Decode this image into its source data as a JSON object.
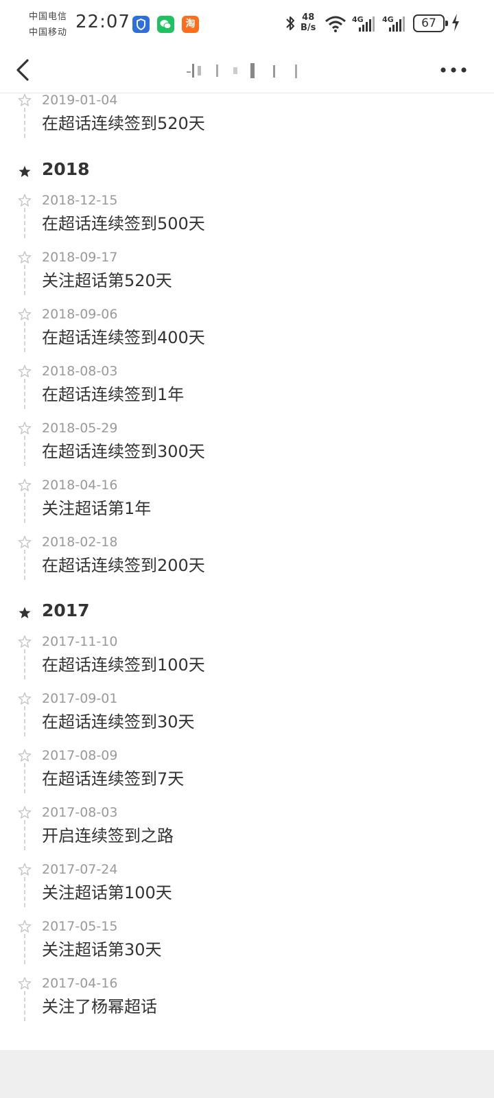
{
  "status_bar": {
    "carrier1": "中国电信",
    "carrier2": "中国移动",
    "time": "22:07",
    "net_speed_value": "48",
    "net_speed_unit": "B/s",
    "battery": "67",
    "app_icons": [
      "security-app-icon",
      "wechat-icon",
      "taobao-icon"
    ],
    "taobao_glyph": "淘"
  },
  "nav": {
    "back_icon": "back-arrow-icon",
    "more_icon": "more-icon"
  },
  "timeline": {
    "top_entry": {
      "date": "2019-01-04",
      "title": "在超话连续签到520天"
    },
    "years": [
      {
        "year": "2018",
        "entries": [
          {
            "date": "2018-12-15",
            "title": "在超话连续签到500天"
          },
          {
            "date": "2018-09-17",
            "title": "关注超话第520天"
          },
          {
            "date": "2018-09-06",
            "title": "在超话连续签到400天"
          },
          {
            "date": "2018-08-03",
            "title": "在超话连续签到1年"
          },
          {
            "date": "2018-05-29",
            "title": "在超话连续签到300天"
          },
          {
            "date": "2018-04-16",
            "title": "关注超话第1年"
          },
          {
            "date": "2018-02-18",
            "title": "在超话连续签到200天"
          }
        ]
      },
      {
        "year": "2017",
        "entries": [
          {
            "date": "2017-11-10",
            "title": "在超话连续签到100天"
          },
          {
            "date": "2017-09-01",
            "title": "在超话连续签到30天"
          },
          {
            "date": "2017-08-09",
            "title": "在超话连续签到7天"
          },
          {
            "date": "2017-08-03",
            "title": "开启连续签到之路"
          },
          {
            "date": "2017-07-24",
            "title": "关注超话第100天"
          },
          {
            "date": "2017-05-15",
            "title": "关注超话第30天"
          },
          {
            "date": "2017-04-16",
            "title": "关注了杨幂超话"
          }
        ]
      }
    ]
  },
  "colors": {
    "text": "#333333",
    "date": "#9a9a9a",
    "dash": "#d5d5d5",
    "star_outline": "#c8c8c8",
    "footer": "#efefef"
  }
}
